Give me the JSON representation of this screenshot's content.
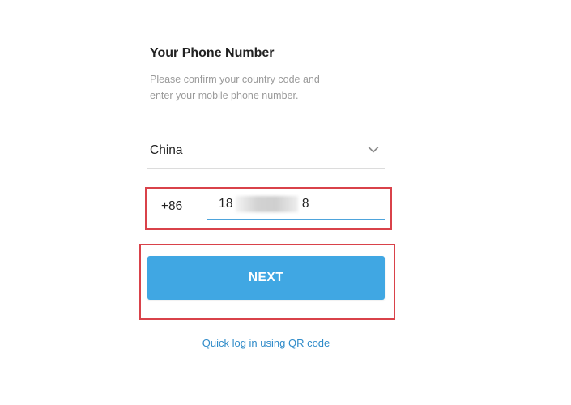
{
  "header": {
    "title": "Your Phone Number",
    "subtitle": "Please confirm your country code and enter your mobile phone number."
  },
  "country_select": {
    "value": "China",
    "icon": "chevron-down-icon"
  },
  "phone": {
    "country_code": "+86",
    "number_prefix": "18",
    "number_suffix": "8"
  },
  "next_button": {
    "label": "NEXT"
  },
  "qr_link": {
    "label": "Quick log in using QR code"
  },
  "colors": {
    "accent": "#40a7e3",
    "link": "#2f8bc9",
    "highlight": "#d9424a",
    "input_underline_active": "#4ea4dc"
  }
}
